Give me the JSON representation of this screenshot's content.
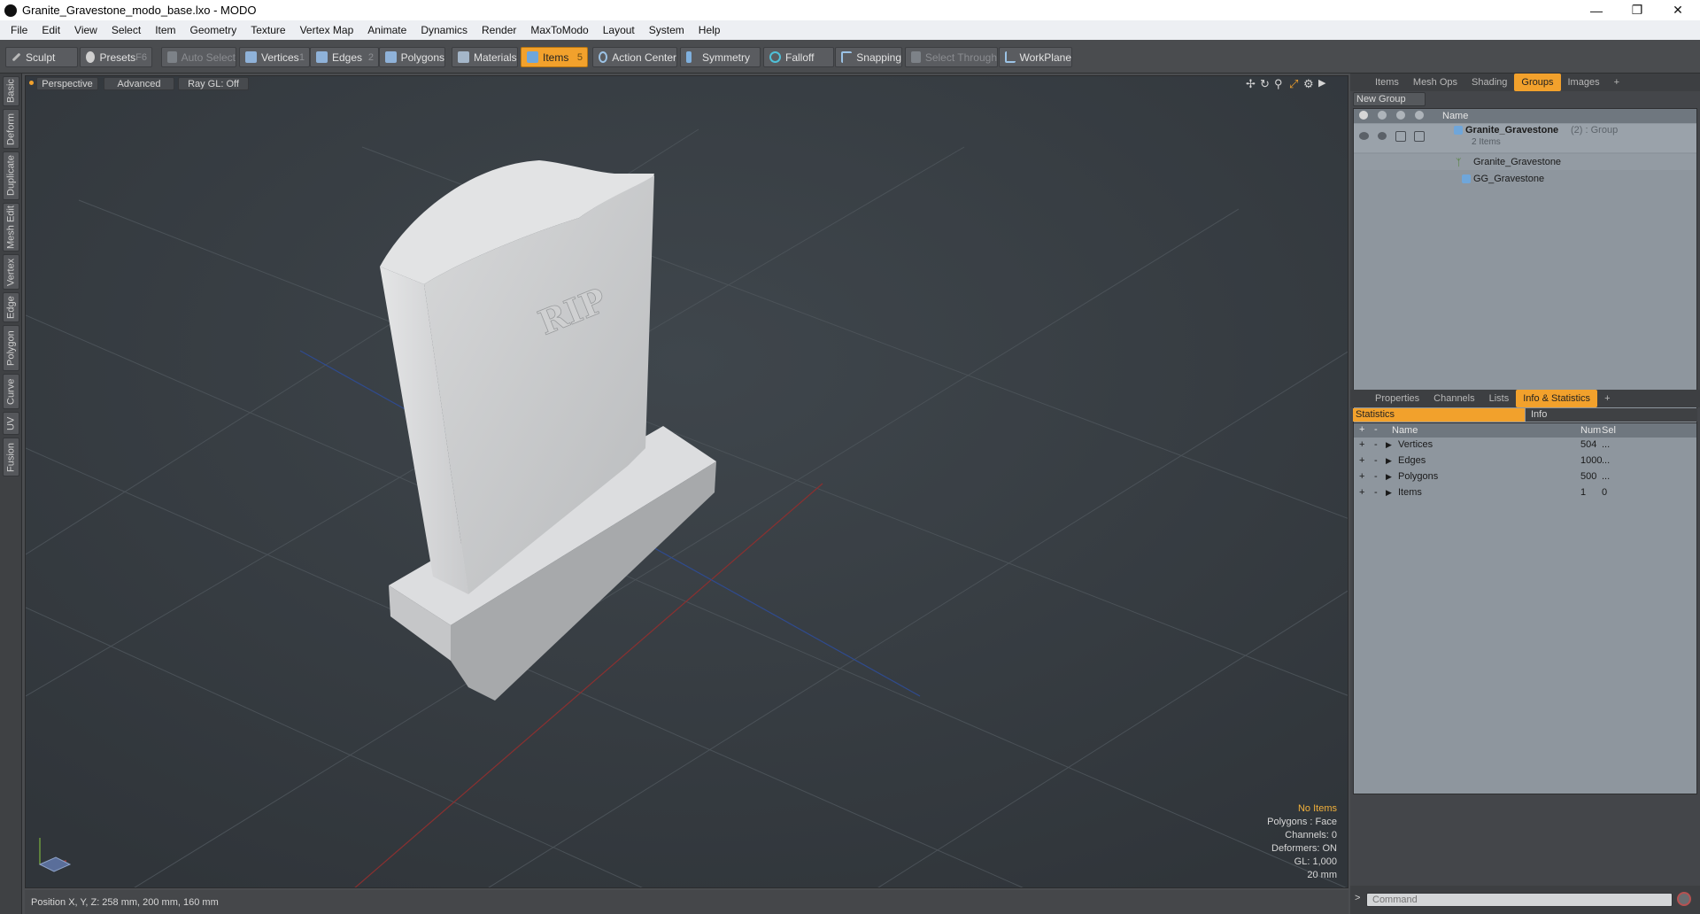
{
  "window": {
    "title": "Granite_Gravestone_modo_base.lxo - MODO"
  },
  "menu": [
    "File",
    "Edit",
    "View",
    "Select",
    "Item",
    "Geometry",
    "Texture",
    "Vertex Map",
    "Animate",
    "Dynamics",
    "Render",
    "MaxToModo",
    "Layout",
    "System",
    "Help"
  ],
  "toolbar": {
    "sculpt": "Sculpt",
    "presets": "Presets",
    "presets_key": "F6",
    "auto_select": "Auto Select",
    "vertices": "Vertices",
    "vertices_key": "1",
    "edges": "Edges",
    "edges_key": "2",
    "polygons": "Polygons",
    "materials": "Materials",
    "items": "Items",
    "items_key": "5",
    "action_center": "Action Center",
    "symmetry": "Symmetry",
    "falloff": "Falloff",
    "snapping": "Snapping",
    "select_through": "Select Through",
    "workplane": "WorkPlane"
  },
  "left_tabs": [
    "Basic",
    "Deform",
    "Duplicate",
    "Mesh Edit",
    "Vertex",
    "Edge",
    "Polygon",
    "Curve",
    "UV",
    "Fusion"
  ],
  "viewport": {
    "view": "Perspective",
    "shading": "Advanced",
    "raygl": "Ray GL: Off",
    "engraving": "RIP",
    "info": {
      "no_items": "No Items",
      "polygons": "Polygons : Face",
      "channels": "Channels: 0",
      "deformers": "Deformers: ON",
      "gl": "GL: 1,000",
      "size": "20 mm"
    }
  },
  "status": {
    "position": "Position X, Y, Z:   258 mm, 200 mm, 160 mm"
  },
  "items_panel": {
    "tabs": [
      "Items",
      "Mesh Ops",
      "Shading",
      "Groups",
      "Images"
    ],
    "active_tab": "Groups",
    "new_group": "New Group",
    "name_header": "Name",
    "group_name": "Granite_Gravestone",
    "group_suffix": " (2) : Group",
    "group_count": "2 Items",
    "children": [
      "Granite_Gravestone",
      "GG_Gravestone"
    ]
  },
  "stats_panel": {
    "tabs": [
      "Properties",
      "Channels",
      "Lists",
      "Info & Statistics"
    ],
    "active_tab": "Info & Statistics",
    "sub_statistics": "Statistics",
    "sub_info": "Info",
    "headers": {
      "name": "Name",
      "num": "Num",
      "sel": "Sel"
    },
    "rows": [
      {
        "name": "Vertices",
        "num": "504",
        "sel": "..."
      },
      {
        "name": "Edges",
        "num": "1000",
        "sel": "..."
      },
      {
        "name": "Polygons",
        "num": "500",
        "sel": "..."
      },
      {
        "name": "Items",
        "num": "1",
        "sel": "0"
      }
    ]
  },
  "command": {
    "placeholder": "Command"
  },
  "colors": {
    "accent": "#f2a12c",
    "viewport_bg": "#3a3f44"
  }
}
